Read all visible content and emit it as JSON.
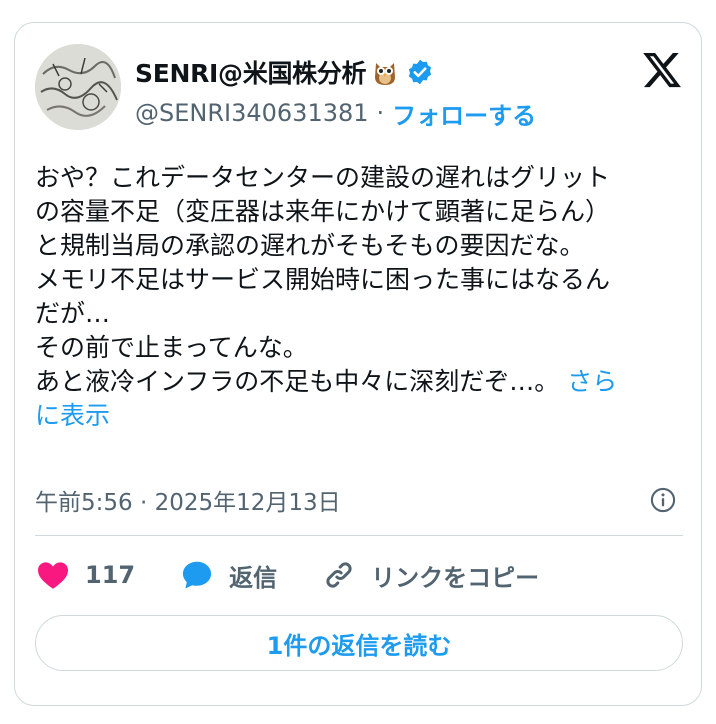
{
  "author": {
    "display_name": "SENRI@米国株分析",
    "handle": "@SENRI340631381",
    "separator": "·",
    "follow_label": "フォローする",
    "emoji_icon": "owl-icon",
    "verified_icon": "verified-badge-icon"
  },
  "tweet": {
    "lines": [
      "おや？これデータセンターの建設の遅れはグリット",
      "の容量不足（変圧器は来年にかけて顕著に足らん）",
      "と規制当局の承認の遅れがそもそもの要因だな。",
      "メモリ不足はサービス開始時に困った事にはなるん",
      "だが…",
      "その前で止まってんな。",
      "あと液冷インフラの不足も中々に深刻だぞ…。"
    ],
    "show_more_first": "さら",
    "show_more_second": "に表示"
  },
  "timestamp": "午前5:56 · 2025年12月13日",
  "actions": {
    "like_count": "117",
    "reply_label": "返信",
    "copy_link_label": "リンクをコピー"
  },
  "read_replies_label": "1件の返信を読む",
  "colors": {
    "accent": "#1d9bf0",
    "like": "#f91880",
    "text": "#0f1419",
    "secondary": "#536471",
    "border": "#cfd9de"
  }
}
